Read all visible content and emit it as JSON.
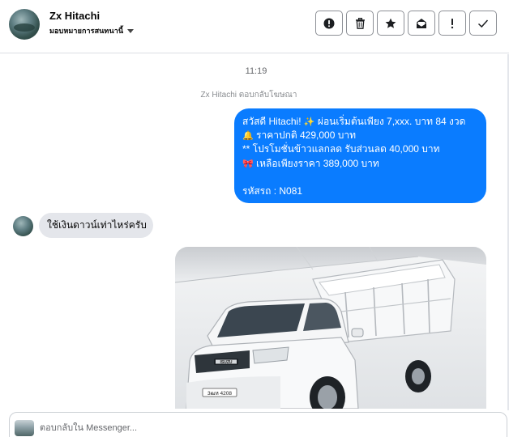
{
  "header": {
    "contact_name": "Zx Hitachi",
    "subtitle": "มอบหมายการสนทนานี้",
    "actions": [
      {
        "name": "report-button",
        "icon": "alert-circle-icon"
      },
      {
        "name": "delete-button",
        "icon": "trash-icon"
      },
      {
        "name": "star-button",
        "icon": "star-icon"
      },
      {
        "name": "mark-unread-button",
        "icon": "envelope-open-icon"
      },
      {
        "name": "flag-important-button",
        "icon": "exclamation-icon"
      },
      {
        "name": "mark-done-button",
        "icon": "checkmark-icon"
      }
    ]
  },
  "conversation": {
    "timestamp": "11:19",
    "reply_note": "Zx Hitachi ตอบกลับโฆษณา",
    "outgoing_message": {
      "line1": "สวัสดี Hitachi!",
      "line1_emoji": "✨",
      "line1_rest": "ผ่อนเริ่มต้นเพียง 7,xxx. บาท 84 งวด",
      "line2_emoji": "🔔",
      "line2": "ราคาปกติ 429,000 บาท",
      "line3": "** โปรโมชั่นข้าวแลกลด รับส่วนลด 40,000 บาท",
      "line4_emoji": "🎀",
      "line4": "เหลือเพียงราคา 389,000 บาท",
      "line5": "รหัสรถ : N081"
    },
    "incoming_message": "ใช้เงินดาวน์เท่าไหร่ครับ",
    "photo": {
      "brand_badge": "ISUZU",
      "plate": "3ฒห 4208"
    }
  },
  "composer": {
    "placeholder": "ตอบกลับใน Messenger..."
  },
  "colors": {
    "outgoing_bubble": "#0a7cff",
    "incoming_bubble": "#e4e6eb",
    "button_border": "#8d9096"
  }
}
